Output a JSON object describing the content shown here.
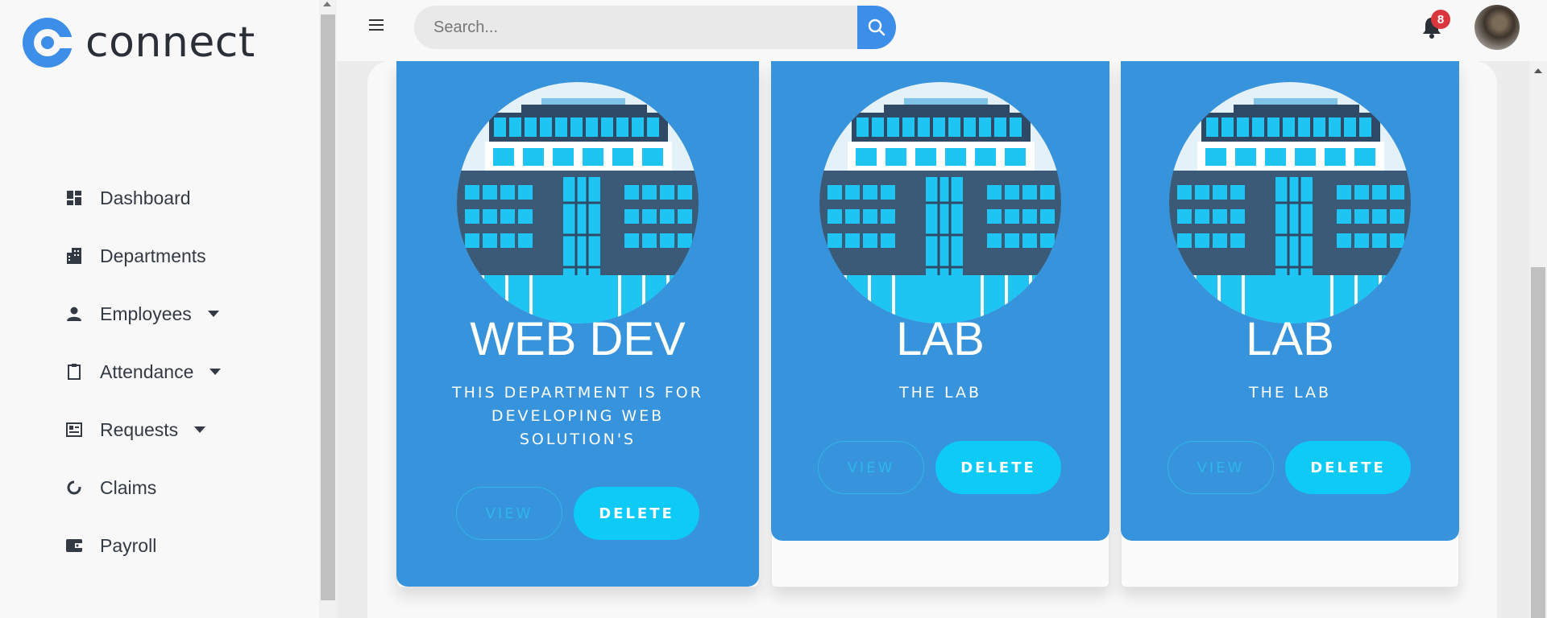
{
  "brand": {
    "name": "connect",
    "accent": "#3d8ee8"
  },
  "sidebar": {
    "items": [
      {
        "label": "Dashboard",
        "icon": "dashboard-icon",
        "has_submenu": false
      },
      {
        "label": "Departments",
        "icon": "building-icon",
        "has_submenu": false
      },
      {
        "label": "Employees",
        "icon": "person-icon",
        "has_submenu": true
      },
      {
        "label": "Attendance",
        "icon": "clipboard-icon",
        "has_submenu": true
      },
      {
        "label": "Requests",
        "icon": "newspaper-icon",
        "has_submenu": true
      },
      {
        "label": "Claims",
        "icon": "pie-chart-icon",
        "has_submenu": false
      },
      {
        "label": "Payroll",
        "icon": "wallet-icon",
        "has_submenu": false
      }
    ]
  },
  "topbar": {
    "search_placeholder": "Search...",
    "notification_count": "8"
  },
  "departments": [
    {
      "name": "WEB DEV",
      "description": "THIS DEPARTMENT IS FOR DEVELOPING WEB SOLUTION'S",
      "view_label": "VIEW",
      "delete_label": "DELETE"
    },
    {
      "name": "LAB",
      "description": "THE LAB",
      "view_label": "VIEW",
      "delete_label": "DELETE"
    },
    {
      "name": "LAB",
      "description": "THE LAB",
      "view_label": "VIEW",
      "delete_label": "DELETE"
    }
  ],
  "colors": {
    "card": "#3693dc",
    "delete_button": "#0dcaf7",
    "badge": "#d9363e"
  }
}
